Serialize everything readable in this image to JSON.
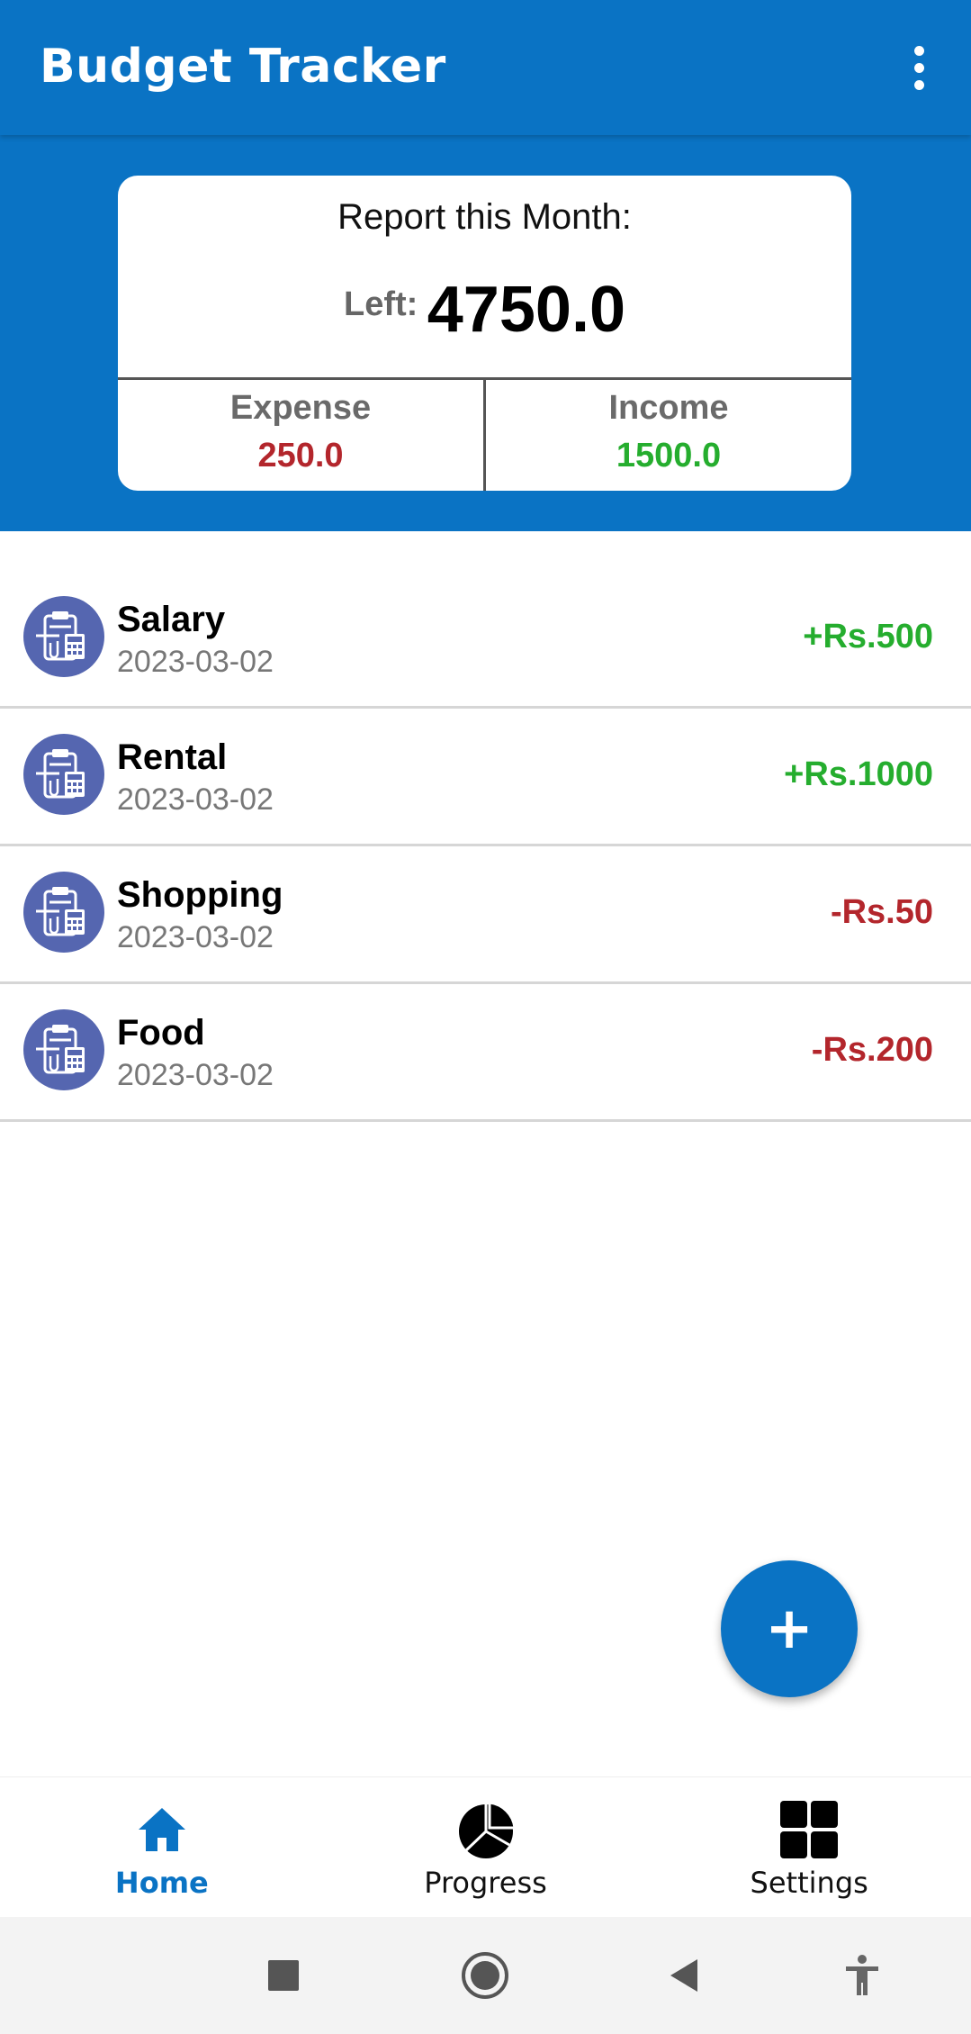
{
  "app_bar": {
    "title": "Budget Tracker",
    "menu_icon": "more-vert-icon",
    "color": "#0a73c4"
  },
  "report": {
    "title": "Report this Month:",
    "left_label": "Left:",
    "left_value": "4750.0",
    "expense_label": "Expense",
    "expense_value": "250.0",
    "income_label": "Income",
    "income_value": "1500.0"
  },
  "transactions": [
    {
      "name": "Salary",
      "date": "2023-03-02",
      "amount": "+Rs.500",
      "type": "income",
      "icon": "accounting-icon"
    },
    {
      "name": "Rental",
      "date": "2023-03-02",
      "amount": "+Rs.1000",
      "type": "income",
      "icon": "accounting-icon"
    },
    {
      "name": "Shopping",
      "date": "2023-03-02",
      "amount": "-Rs.50",
      "type": "expense",
      "icon": "accounting-icon"
    },
    {
      "name": "Food",
      "date": "2023-03-02",
      "amount": "-Rs.200",
      "type": "expense",
      "icon": "accounting-icon"
    }
  ],
  "fab": {
    "icon": "plus-icon",
    "symbol": "+"
  },
  "bottom_nav": {
    "items": [
      {
        "label": "Home",
        "icon": "home-icon",
        "active": true
      },
      {
        "label": "Progress",
        "icon": "pie-chart-icon",
        "active": false
      },
      {
        "label": "Settings",
        "icon": "grid-icon",
        "active": false
      }
    ]
  },
  "system_nav": {
    "buttons": [
      "recents-icon",
      "home-circle-icon",
      "back-icon",
      "accessibility-icon"
    ]
  },
  "colors": {
    "primary": "#0a73c4",
    "income": "#25ad2e",
    "expense": "#b3262c",
    "avatar": "#5566b0"
  }
}
